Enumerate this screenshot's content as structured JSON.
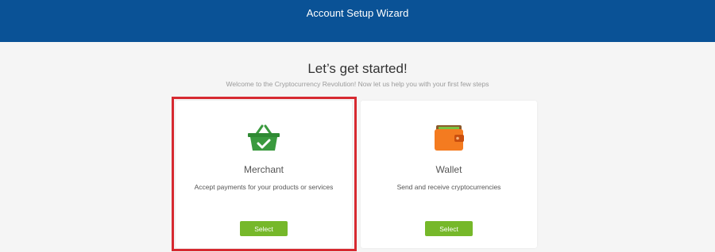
{
  "header": {
    "title": "Account Setup Wizard"
  },
  "intro": {
    "title": "Let’s get started!",
    "subtitle": "Welcome to the Cryptocurrency Revolution! Now let us help you with your first few steps"
  },
  "cards": [
    {
      "icon": "shopping-basket-icon",
      "title": "Merchant",
      "description": "Accept payments for your products or services",
      "button_label": "Select",
      "highlighted": true
    },
    {
      "icon": "wallet-icon",
      "title": "Wallet",
      "description": "Send and receive cryptocurrencies",
      "button_label": "Select",
      "highlighted": false
    }
  ],
  "colors": {
    "header_bg": "#0a5296",
    "button_bg": "#76b82a",
    "highlight_border": "#d72a31",
    "basket_green": "#3a9a3e",
    "wallet_orange": "#f47b20"
  }
}
